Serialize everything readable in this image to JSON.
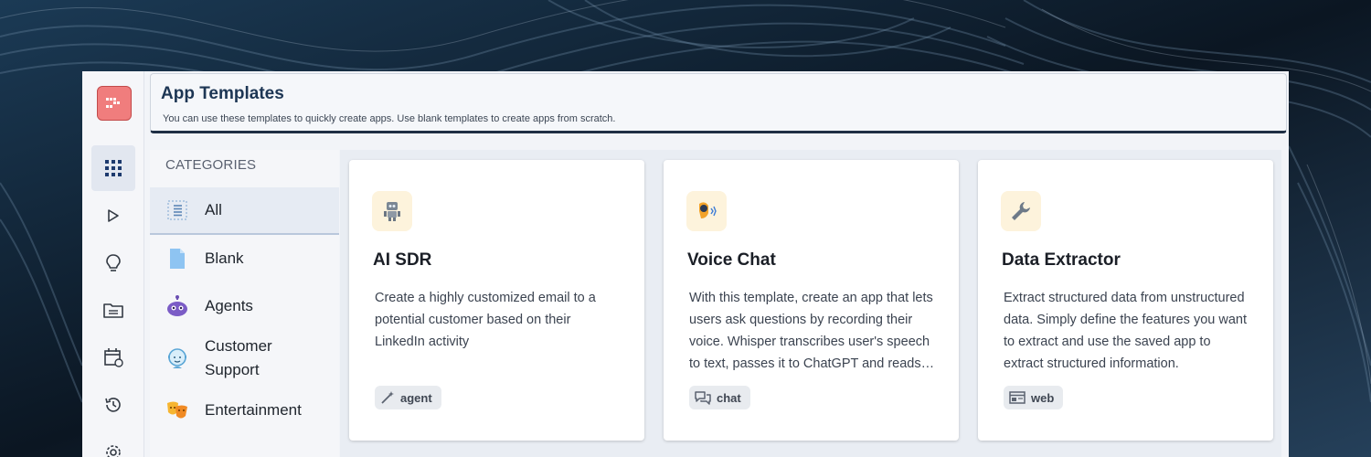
{
  "header": {
    "title": "App Templates",
    "subtitle": "You can use these templates to quickly create apps. Use blank templates to create apps from scratch."
  },
  "rail": {
    "items": [
      {
        "icon": "grid-icon",
        "active": true
      },
      {
        "icon": "play-icon",
        "active": false
      },
      {
        "icon": "lightbulb-icon",
        "active": false
      },
      {
        "icon": "folder-icon",
        "active": false
      },
      {
        "icon": "calendar-icon",
        "active": false
      },
      {
        "icon": "history-icon",
        "active": false
      },
      {
        "icon": "gear-icon",
        "active": false
      }
    ]
  },
  "categories": {
    "title": "CATEGORIES",
    "items": [
      {
        "label": "All",
        "icon": "list-icon",
        "active": true
      },
      {
        "label": "Blank",
        "icon": "file-icon",
        "active": false
      },
      {
        "label": "Agents",
        "icon": "robot-icon",
        "active": false
      },
      {
        "label": "Customer Support",
        "icon": "support-icon",
        "active": false
      },
      {
        "label": "Entertainment",
        "icon": "theater-masks-icon",
        "active": false
      }
    ]
  },
  "templates": [
    {
      "title": "AI SDR",
      "icon": "robot-icon",
      "description": "Create a highly customized email to a potential customer based on their LinkedIn activity",
      "tag": "agent",
      "tag_icon": "magic-wand-icon"
    },
    {
      "title": "Voice Chat",
      "icon": "speaking-person-icon",
      "description": "With this template, create an app that lets users ask questions by recording their voice. Whisper transcribes user's speech to text, passes it to ChatGPT and reads out the response.",
      "tag": "chat",
      "tag_icon": "chat-bubbles-icon"
    },
    {
      "title": "Data Extractor",
      "icon": "wrench-icon",
      "description": "Extract structured data from unstructured data. Simply define the features you want to extract and use the saved app to extract structured information.",
      "tag": "web",
      "tag_icon": "browser-window-icon"
    }
  ],
  "colors": {
    "accent": "#1d3654",
    "logo": "#f07d7d",
    "icon_tile": "#fdf3dc"
  }
}
